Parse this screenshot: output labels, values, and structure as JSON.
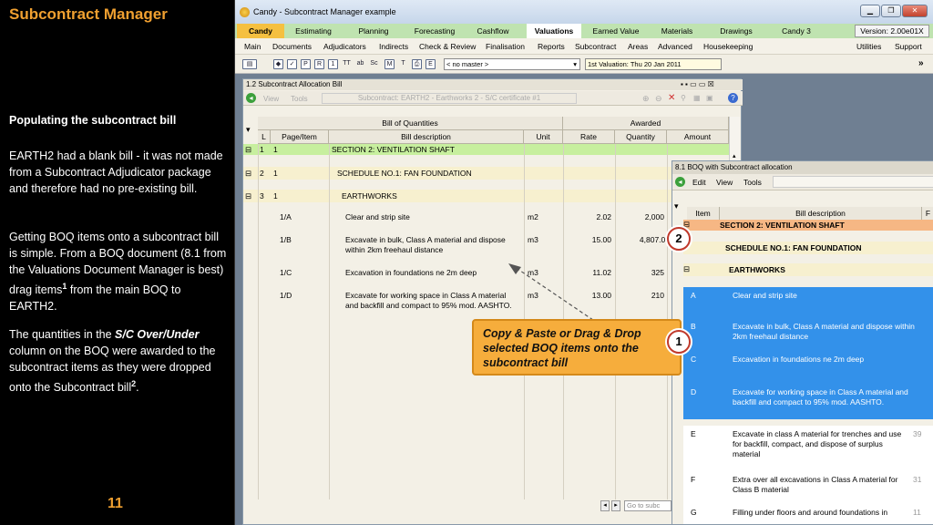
{
  "slide": {
    "title": "Subcontract Manager",
    "section_heading": "Populating the subcontract bill",
    "p1": "EARTH2 had a blank bill - it was not made from a Subcontract Adjudicator package and therefore had no pre-existing bill.",
    "p2_a": "Getting BOQ items onto a subcontract bill is simple.  From a BOQ document (8.1 from the Valuations Document Manager is best) drag items",
    "p2_sup": "1",
    "p2_b": " from the main BOQ to EARTH2.",
    "p3_a": "The quantities in the ",
    "p3_em": "S/C Over/Under",
    "p3_b": " column on the BOQ were awarded to the subcontract items as they were dropped onto the Subcontract bill",
    "p3_sup": "2",
    "p3_c": ".",
    "page_number": "11"
  },
  "app": {
    "window_title": "Candy - Subcontract Manager example",
    "version": "Version: 2.00e01X",
    "tabs": [
      "Candy",
      "Estimating",
      "Planning",
      "Forecasting",
      "Cashflow",
      "Valuations",
      "Earned Value",
      "Materials",
      "Drawings",
      "Candy 3"
    ],
    "active_tab": "Valuations",
    "menu": [
      "Main",
      "Documents",
      "Adjudicators",
      "Indirects",
      "Check & Review",
      "Finalisation",
      "Reports",
      "Subcontract",
      "Areas",
      "Advanced",
      "Housekeeping"
    ],
    "menu_right": [
      "Utilities",
      "Support"
    ],
    "master_select": "< no master >",
    "valuation": "1st Valuation: Thu 20 Jan 2011",
    "more_icon": "double-chevron-right-icon"
  },
  "alloc_bill": {
    "title": "1.2 Subcontract Allocation Bill",
    "menu": [
      "View",
      "Tools"
    ],
    "breadcrumb": "Subcontract: EARTH2 - Earthworks 2 - S/C certificate #1",
    "group_boq": "Bill of Quantities",
    "group_awarded": "Awarded",
    "columns": [
      "L",
      "Page/Item",
      "Bill description",
      "Unit",
      "Rate",
      "Quantity",
      "Amount"
    ],
    "rows": [
      {
        "tree": "1",
        "level": "1",
        "item": "",
        "desc": "SECTION 2: VENTILATION SHAFT",
        "unit": "",
        "rate": "",
        "qty": "",
        "amount": "",
        "kind": "section"
      },
      {
        "tree": "2",
        "level": "1",
        "item": "",
        "desc": "SCHEDULE NO.1: FAN FOUNDATION",
        "unit": "",
        "rate": "",
        "qty": "",
        "amount": "",
        "kind": "schedule"
      },
      {
        "tree": "3",
        "level": "1",
        "item": "",
        "desc": "EARTHWORKS",
        "unit": "",
        "rate": "",
        "qty": "",
        "amount": "",
        "kind": "schedule"
      },
      {
        "tree": "",
        "level": "",
        "item": "1/A",
        "desc": "Clear and strip site",
        "unit": "m2",
        "rate": "2.02",
        "qty": "2,000",
        "amount": "",
        "kind": "item"
      },
      {
        "tree": "",
        "level": "",
        "item": "1/B",
        "desc": "Excavate in bulk, Class A material and dispose within 2km freehaul distance",
        "unit": "m3",
        "rate": "15.00",
        "qty": "4,807.07",
        "amount": "",
        "kind": "item"
      },
      {
        "tree": "",
        "level": "",
        "item": "1/C",
        "desc": "Excavation in foundations ne 2m deep",
        "unit": "m3",
        "rate": "11.02",
        "qty": "325",
        "amount": "",
        "kind": "item"
      },
      {
        "tree": "",
        "level": "",
        "item": "1/D",
        "desc": "Excavate for working space in Class A material and backfill and compact to 95% mod. AASHTO.",
        "unit": "m3",
        "rate": "13.00",
        "qty": "210",
        "amount": "",
        "kind": "item"
      }
    ],
    "go_to": "Go to subc"
  },
  "boq": {
    "title": "8.1 BOQ with Subcontract allocation",
    "menu": [
      "Edit",
      "View",
      "Tools"
    ],
    "columns": [
      "Item",
      "Bill description",
      "F"
    ],
    "rows": [
      {
        "item": "",
        "desc": "SECTION 2: VENTILATION SHAFT",
        "kind": "section"
      },
      {
        "item": "",
        "desc": "SCHEDULE NO.1: FAN FOUNDATION",
        "kind": "schedule"
      },
      {
        "item": "",
        "desc": "EARTHWORKS",
        "kind": "schedule"
      },
      {
        "item": "A",
        "desc": "Clear and strip site",
        "kind": "sel"
      },
      {
        "item": "B",
        "desc": "Excavate in bulk, Class A material and dispose within 2km freehaul distance",
        "kind": "sel"
      },
      {
        "item": "C",
        "desc": "Excavation in foundations ne 2m deep",
        "kind": "sel"
      },
      {
        "item": "D",
        "desc": "Excavate for working space in Class A material and backfill and compact to 95% mod. AASHTO.",
        "kind": "sel"
      },
      {
        "item": "E",
        "desc": "Excavate in class A material for trenches and use for backfill, compact, and dispose of surplus material",
        "extra": "39",
        "kind": "item"
      },
      {
        "item": "F",
        "desc": "Extra over all excavations in Class A material for Class B material",
        "extra": "31",
        "kind": "item"
      },
      {
        "item": "G",
        "desc": "Filling under floors and around foundations in",
        "extra": "11",
        "kind": "item"
      }
    ]
  },
  "callout": {
    "text": "Copy & Paste or Drag & Drop selected BOQ items onto the subcontract bill",
    "badge1": "1",
    "badge2": "2"
  }
}
